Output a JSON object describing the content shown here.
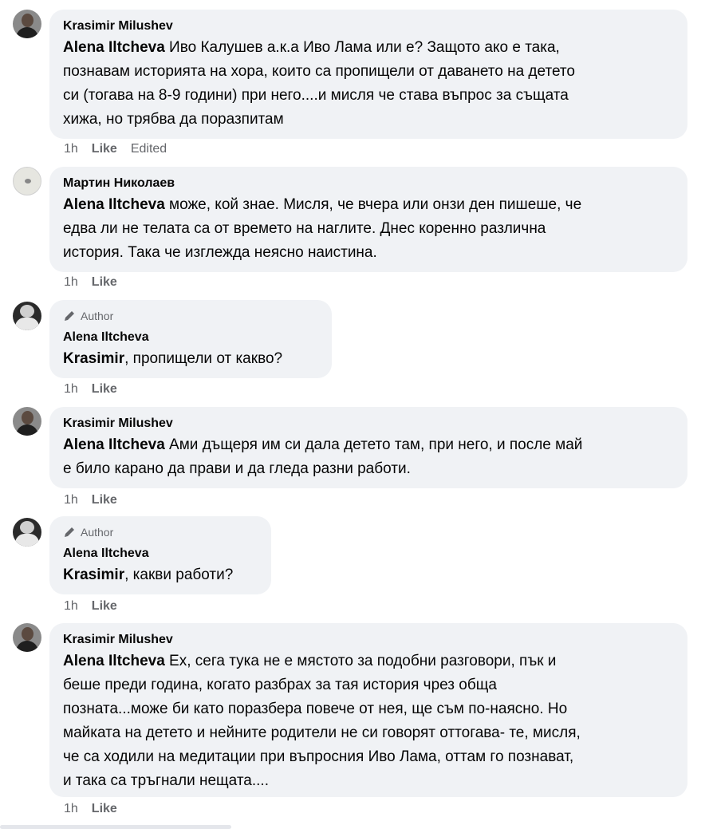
{
  "comments": [
    {
      "name": "Krasimir Milushev",
      "mention": "Alena Iltcheva",
      "text": " Иво Калушев а.к.а Иво Лама или е? Защото ако е така,",
      "lines": [
        "познавам историята на хора, които са пропищели от даването на детето",
        "си (тогава на 8-9 години) при него....и мисля че става въпрос за същата",
        "хижа, но трябва да поразпитам"
      ],
      "time": "1h",
      "like": "Like",
      "edited": "Edited"
    },
    {
      "name": "Мартин Николаев",
      "mention": "Alena Iltcheva",
      "text": " може, кой знае. Мисля, че вчера или онзи ден пишеше, че",
      "lines": [
        "едва ли не телата са от времето на наглите. Днес коренно различна",
        "история. Така че изглежда неясно наистина."
      ],
      "time": "1h",
      "like": "Like"
    },
    {
      "author_tag": "Author",
      "name": "Alena Iltcheva",
      "mention": "Krasimir",
      "text": ", пропищели от какво?",
      "time": "1h",
      "like": "Like"
    },
    {
      "name": "Krasimir Milushev",
      "mention": "Alena Iltcheva",
      "text": " Ами дъщеря им си дала детето там, при него, и после май",
      "lines": [
        "е било карано да прави и да гледа разни работи."
      ],
      "time": "1h",
      "like": "Like"
    },
    {
      "author_tag": "Author",
      "name": "Alena Iltcheva",
      "mention": "Krasimir",
      "text": ", какви работи?",
      "time": "1h",
      "like": "Like"
    },
    {
      "name": "Krasimir Milushev",
      "mention": "Alena Iltcheva",
      "text": " Ех, сега тука не е мястото за подобни разговори, пък и",
      "lines": [
        "беше преди година, когато разбрах за тая история чрез обща",
        "позната...може би като поразбера повече от нея, ще съм по-наясно. Но",
        "майката на детето и нейните родители не си говорят оттогава- те, мисля,",
        "че са ходили на медитации при въпросния Иво Лама, оттам го познават,",
        "и така са тръгнали нещата...."
      ],
      "time": "1h",
      "like": "Like"
    }
  ]
}
